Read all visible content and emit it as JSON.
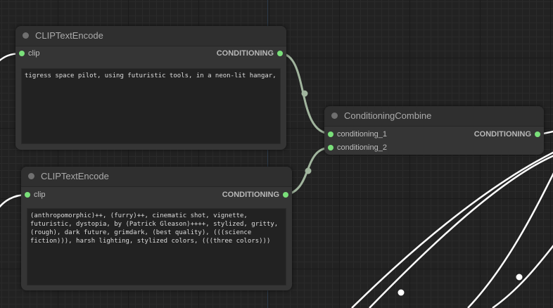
{
  "nodes": [
    {
      "title": "CLIPTextEncode",
      "input": "clip",
      "output": "CONDITIONING",
      "text": "tigress space pilot, using futuristic tools, in a neon-lit hangar,"
    },
    {
      "title": "CLIPTextEncode",
      "input": "clip",
      "output": "CONDITIONING",
      "text": "(anthropomorphic)++, (furry)++, cinematic shot, vignette, futuristic, dystopia, by (Patrick Gleason)++++, stylized, gritty, (rough), dark future, grimdark, (best quality), (((science fiction))), harsh lighting, stylized colors, (((three colors)))"
    },
    {
      "title": "ConditioningCombine",
      "inputs": [
        "conditioning_1",
        "conditioning_2"
      ],
      "output": "CONDITIONING"
    }
  ],
  "colors": {
    "background": "#222222",
    "node_body": "#353535",
    "node_title": "#2f2f2f",
    "slot_conditioning": "#7ae07a",
    "link_conditioning": "#a1b59e",
    "link_other": "#ffffff"
  }
}
